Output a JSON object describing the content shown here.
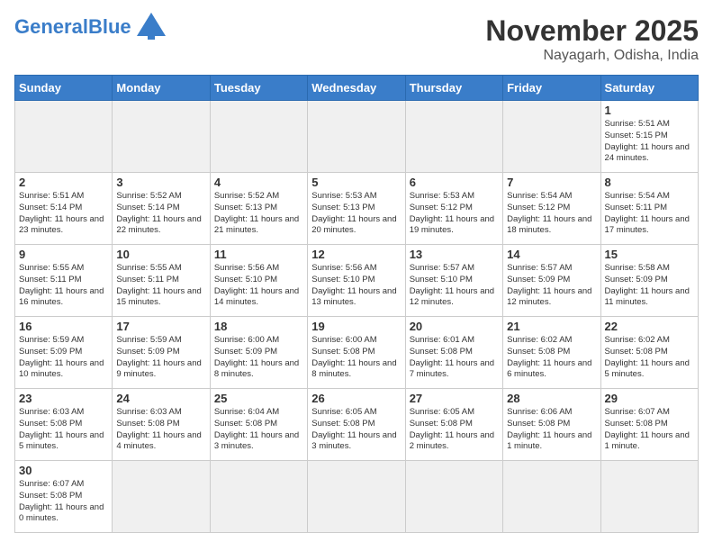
{
  "header": {
    "logo": {
      "general": "General",
      "blue": "Blue"
    },
    "title": "November 2025",
    "location": "Nayagarh, Odisha, India"
  },
  "weekdays": [
    "Sunday",
    "Monday",
    "Tuesday",
    "Wednesday",
    "Thursday",
    "Friday",
    "Saturday"
  ],
  "weeks": [
    [
      {
        "day": "",
        "info": ""
      },
      {
        "day": "",
        "info": ""
      },
      {
        "day": "",
        "info": ""
      },
      {
        "day": "",
        "info": ""
      },
      {
        "day": "",
        "info": ""
      },
      {
        "day": "",
        "info": ""
      },
      {
        "day": "1",
        "info": "Sunrise: 5:51 AM\nSunset: 5:15 PM\nDaylight: 11 hours\nand 24 minutes."
      }
    ],
    [
      {
        "day": "2",
        "info": "Sunrise: 5:51 AM\nSunset: 5:14 PM\nDaylight: 11 hours\nand 23 minutes."
      },
      {
        "day": "3",
        "info": "Sunrise: 5:52 AM\nSunset: 5:14 PM\nDaylight: 11 hours\nand 22 minutes."
      },
      {
        "day": "4",
        "info": "Sunrise: 5:52 AM\nSunset: 5:13 PM\nDaylight: 11 hours\nand 21 minutes."
      },
      {
        "day": "5",
        "info": "Sunrise: 5:53 AM\nSunset: 5:13 PM\nDaylight: 11 hours\nand 20 minutes."
      },
      {
        "day": "6",
        "info": "Sunrise: 5:53 AM\nSunset: 5:12 PM\nDaylight: 11 hours\nand 19 minutes."
      },
      {
        "day": "7",
        "info": "Sunrise: 5:54 AM\nSunset: 5:12 PM\nDaylight: 11 hours\nand 18 minutes."
      },
      {
        "day": "8",
        "info": "Sunrise: 5:54 AM\nSunset: 5:11 PM\nDaylight: 11 hours\nand 17 minutes."
      }
    ],
    [
      {
        "day": "9",
        "info": "Sunrise: 5:55 AM\nSunset: 5:11 PM\nDaylight: 11 hours\nand 16 minutes."
      },
      {
        "day": "10",
        "info": "Sunrise: 5:55 AM\nSunset: 5:11 PM\nDaylight: 11 hours\nand 15 minutes."
      },
      {
        "day": "11",
        "info": "Sunrise: 5:56 AM\nSunset: 5:10 PM\nDaylight: 11 hours\nand 14 minutes."
      },
      {
        "day": "12",
        "info": "Sunrise: 5:56 AM\nSunset: 5:10 PM\nDaylight: 11 hours\nand 13 minutes."
      },
      {
        "day": "13",
        "info": "Sunrise: 5:57 AM\nSunset: 5:10 PM\nDaylight: 11 hours\nand 12 minutes."
      },
      {
        "day": "14",
        "info": "Sunrise: 5:57 AM\nSunset: 5:09 PM\nDaylight: 11 hours\nand 12 minutes."
      },
      {
        "day": "15",
        "info": "Sunrise: 5:58 AM\nSunset: 5:09 PM\nDaylight: 11 hours\nand 11 minutes."
      }
    ],
    [
      {
        "day": "16",
        "info": "Sunrise: 5:59 AM\nSunset: 5:09 PM\nDaylight: 11 hours\nand 10 minutes."
      },
      {
        "day": "17",
        "info": "Sunrise: 5:59 AM\nSunset: 5:09 PM\nDaylight: 11 hours\nand 9 minutes."
      },
      {
        "day": "18",
        "info": "Sunrise: 6:00 AM\nSunset: 5:09 PM\nDaylight: 11 hours\nand 8 minutes."
      },
      {
        "day": "19",
        "info": "Sunrise: 6:00 AM\nSunset: 5:08 PM\nDaylight: 11 hours\nand 8 minutes."
      },
      {
        "day": "20",
        "info": "Sunrise: 6:01 AM\nSunset: 5:08 PM\nDaylight: 11 hours\nand 7 minutes."
      },
      {
        "day": "21",
        "info": "Sunrise: 6:02 AM\nSunset: 5:08 PM\nDaylight: 11 hours\nand 6 minutes."
      },
      {
        "day": "22",
        "info": "Sunrise: 6:02 AM\nSunset: 5:08 PM\nDaylight: 11 hours\nand 5 minutes."
      }
    ],
    [
      {
        "day": "23",
        "info": "Sunrise: 6:03 AM\nSunset: 5:08 PM\nDaylight: 11 hours\nand 5 minutes."
      },
      {
        "day": "24",
        "info": "Sunrise: 6:03 AM\nSunset: 5:08 PM\nDaylight: 11 hours\nand 4 minutes."
      },
      {
        "day": "25",
        "info": "Sunrise: 6:04 AM\nSunset: 5:08 PM\nDaylight: 11 hours\nand 3 minutes."
      },
      {
        "day": "26",
        "info": "Sunrise: 6:05 AM\nSunset: 5:08 PM\nDaylight: 11 hours\nand 3 minutes."
      },
      {
        "day": "27",
        "info": "Sunrise: 6:05 AM\nSunset: 5:08 PM\nDaylight: 11 hours\nand 2 minutes."
      },
      {
        "day": "28",
        "info": "Sunrise: 6:06 AM\nSunset: 5:08 PM\nDaylight: 11 hours\nand 1 minute."
      },
      {
        "day": "29",
        "info": "Sunrise: 6:07 AM\nSunset: 5:08 PM\nDaylight: 11 hours\nand 1 minute."
      }
    ],
    [
      {
        "day": "30",
        "info": "Sunrise: 6:07 AM\nSunset: 5:08 PM\nDaylight: 11 hours\nand 0 minutes."
      },
      {
        "day": "",
        "info": ""
      },
      {
        "day": "",
        "info": ""
      },
      {
        "day": "",
        "info": ""
      },
      {
        "day": "",
        "info": ""
      },
      {
        "day": "",
        "info": ""
      },
      {
        "day": "",
        "info": ""
      }
    ]
  ]
}
